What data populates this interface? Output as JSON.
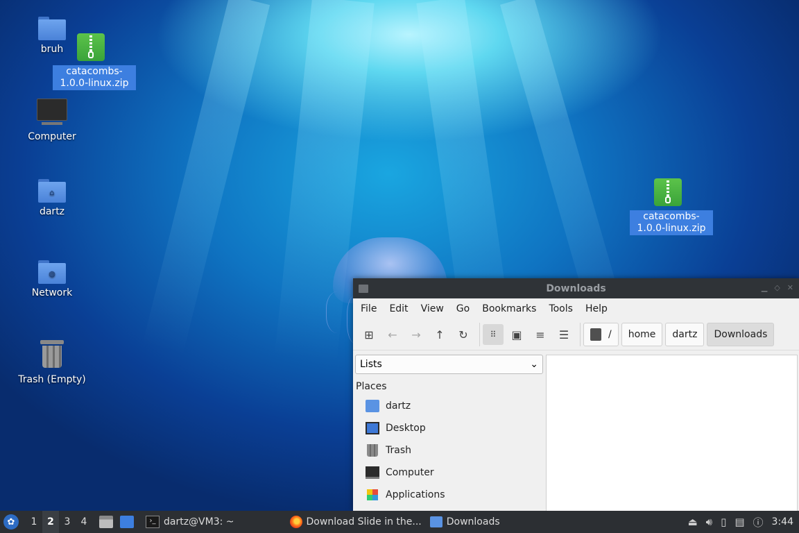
{
  "desktop": {
    "icons": [
      {
        "label": "bruh"
      },
      {
        "label": "catacombs-1.0.0-linux.zip"
      },
      {
        "label": "Computer"
      },
      {
        "label": "dartz"
      },
      {
        "label": "Network"
      },
      {
        "label": "Trash (Empty)"
      },
      {
        "label": "catacombs-1.0.0-linux.zip"
      }
    ]
  },
  "window": {
    "title": "Downloads",
    "menu": [
      "File",
      "Edit",
      "View",
      "Go",
      "Bookmarks",
      "Tools",
      "Help"
    ],
    "breadcrumb": [
      "/",
      "home",
      "dartz",
      "Downloads"
    ],
    "side_combo": "Lists",
    "places_header": "Places",
    "places": [
      {
        "label": "dartz",
        "icon": "home-folder-icon"
      },
      {
        "label": "Desktop",
        "icon": "desktop-icon"
      },
      {
        "label": "Trash",
        "icon": "trash-icon"
      },
      {
        "label": "Computer",
        "icon": "computer-icon"
      },
      {
        "label": "Applications",
        "icon": "applications-icon"
      }
    ]
  },
  "taskbar": {
    "workspaces": [
      "1",
      "2",
      "3",
      "4"
    ],
    "current_workspace": "2",
    "tasks": [
      {
        "label": "dartz@VM3: ~",
        "icon": "terminal-icon"
      },
      {
        "label": "Download Slide in the...",
        "icon": "firefox-icon"
      },
      {
        "label": "Downloads",
        "icon": "folder-icon"
      }
    ],
    "clock": "3:44"
  }
}
